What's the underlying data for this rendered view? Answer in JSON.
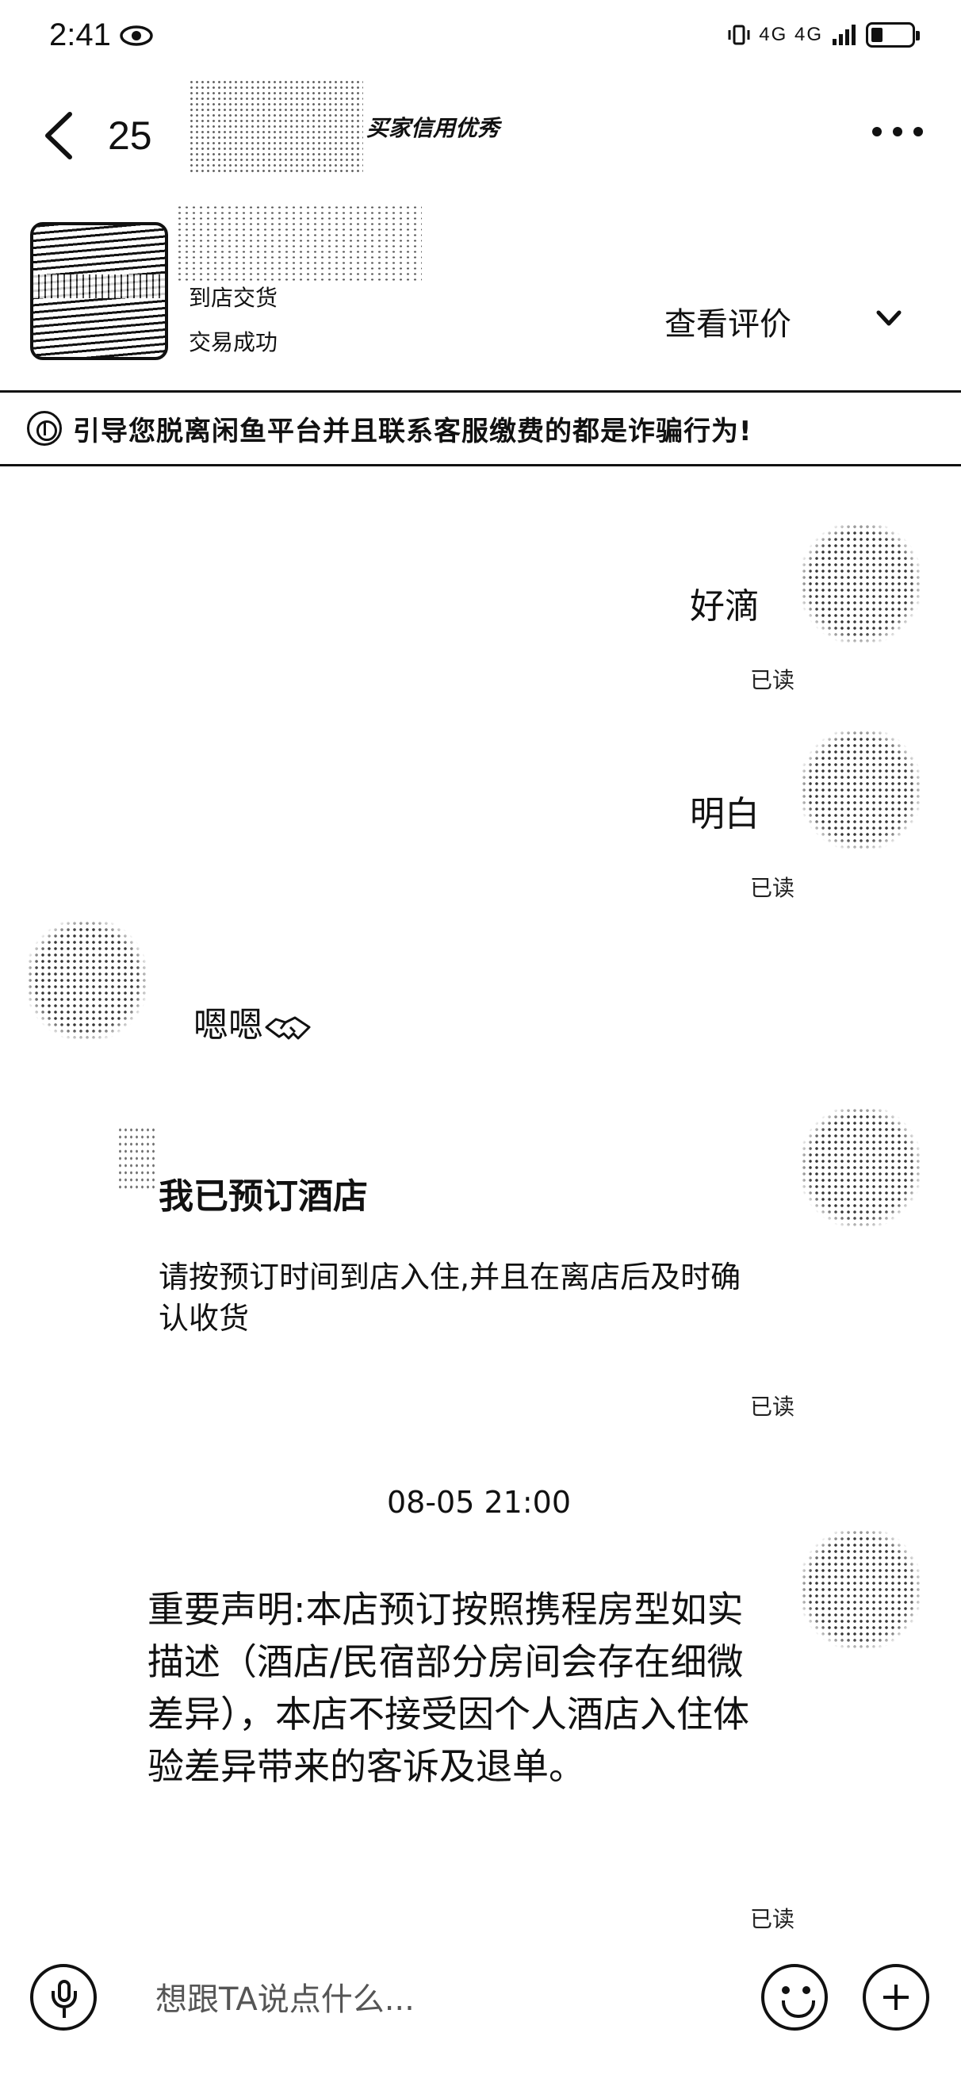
{
  "status_bar": {
    "time": "2:41",
    "network": "4G 4G"
  },
  "header": {
    "back_count": "25",
    "credit_badge": "买家信用优秀"
  },
  "product": {
    "type": "到店交货",
    "status": "交易成功",
    "review_label": "查看评价"
  },
  "warning": {
    "text": "引导您脱离闲鱼平台并且联系客服缴费的都是诈骗行为!"
  },
  "messages": [
    {
      "from": "me",
      "text": "好滴",
      "read": "已读"
    },
    {
      "from": "me",
      "text": "明白",
      "read": "已读"
    },
    {
      "from": "other",
      "text": "嗯嗯"
    },
    {
      "from": "me",
      "type": "order-card",
      "title": "我已预订酒店",
      "body": "请按预订时间到店入住,并且在离店后及时确认收货",
      "read": "已读"
    },
    {
      "from": "me",
      "text": "重要声明:本店预订按照携程房型如实描述（酒店/民宿部分房间会存在细微差异），本店不接受因个人酒店入住体验差异带来的客诉及退单。",
      "read": "已读"
    }
  ],
  "timestamp": "08-05 21:00",
  "input": {
    "placeholder": "想跟TA说点什么..."
  }
}
